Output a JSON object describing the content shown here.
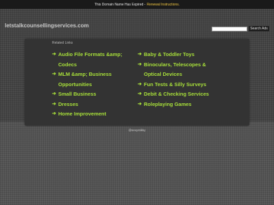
{
  "topbar": {
    "notice": "This Domain Name Has Expired -",
    "link": "Renewal Instructions."
  },
  "header": {
    "domain": "letstalkcounsellingservices.com",
    "search_placeholder": "",
    "search_button": "Search Ads"
  },
  "panel": {
    "title": "Related Links",
    "left_links": [
      {
        "line1": "Audio File Formats &amp;",
        "line2": "Codecs"
      },
      {
        "line1": "MLM &amp; Business",
        "line2": "Opportunities"
      },
      {
        "line1": "Small Business"
      },
      {
        "line1": "Dresses"
      },
      {
        "line1": "Home Improvement"
      }
    ],
    "right_links": [
      {
        "line1": "Baby & Toddler Toys"
      },
      {
        "line1": "Binoculars, Telescopes &",
        "line2": "Optical Devices"
      },
      {
        "line1": "Fun Tests & Silly Surveys"
      },
      {
        "line1": "Debit & Checking Services"
      },
      {
        "line1": "Roleplaying Games"
      }
    ],
    "arrow": "➔"
  },
  "footer": {
    "text": "@sexystikky"
  },
  "colors": {
    "link": "#a8e03a",
    "panel_bg": "#333333",
    "topbar_bg": "#1a1a1a",
    "notice_link": "#f4c842"
  }
}
